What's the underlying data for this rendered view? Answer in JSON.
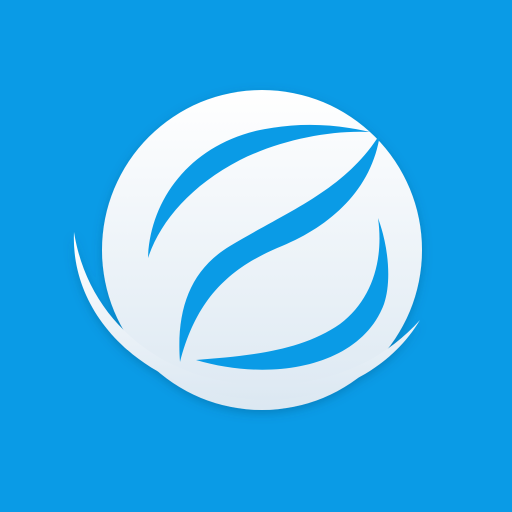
{
  "icon": {
    "name": "leaf-globe-icon",
    "colors": {
      "background": "#0A9BE6",
      "emblem_light": "#FFFFFF",
      "emblem_shade": "#DCE8F2"
    }
  }
}
